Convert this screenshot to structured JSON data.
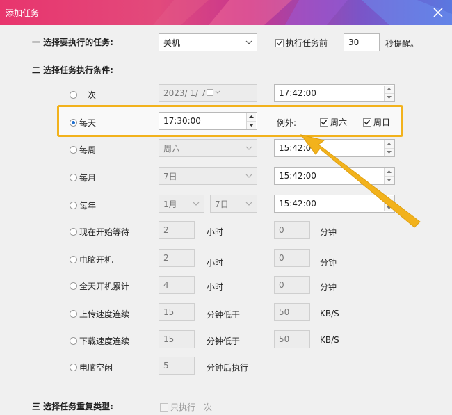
{
  "window": {
    "title": "添加任务"
  },
  "section1": {
    "label": "一 选择要执行的任务:",
    "task_value": "关机",
    "remind_label": "执行任务前",
    "remind_value": "30",
    "remind_suffix": "秒提醒。"
  },
  "section2": {
    "label": "二 选择任务执行条件:",
    "once": {
      "label": "一次",
      "date": "2023/  1/  7",
      "time": "17:42:00"
    },
    "daily": {
      "label": "每天",
      "time": "17:30:00",
      "except_label": "例外:",
      "sat_label": "周六",
      "sun_label": "周日"
    },
    "weekly": {
      "label": "每周",
      "day": "周六",
      "time": "15:42:00"
    },
    "monthly": {
      "label": "每月",
      "day": "7日",
      "time": "15:42:00"
    },
    "yearly": {
      "label": "每年",
      "month": "1月",
      "day": "7日",
      "time": "15:42:00"
    },
    "wait": {
      "label": "现在开始等待",
      "hours": "2",
      "hours_unit": "小时",
      "minutes": "0",
      "minutes_unit": "分钟"
    },
    "boot": {
      "label": "电脑开机",
      "hours": "2",
      "hours_unit": "小时",
      "minutes": "0",
      "minutes_unit": "分钟"
    },
    "cumulative": {
      "label": "全天开机累计",
      "hours": "4",
      "hours_unit": "小时",
      "minutes": "0",
      "minutes_unit": "分钟"
    },
    "upload": {
      "label": "上传速度连续",
      "minutes": "15",
      "minutes_unit": "分钟低于",
      "speed": "50",
      "speed_unit": "KB/S"
    },
    "download": {
      "label": "下载速度连续",
      "minutes": "15",
      "minutes_unit": "分钟低于",
      "speed": "50",
      "speed_unit": "KB/S"
    },
    "idle": {
      "label": "电脑空闲",
      "minutes": "5",
      "minutes_unit": "分钟后执行"
    }
  },
  "section3": {
    "label": "三 选择任务重复类型:",
    "once_only_label": "只执行一次"
  },
  "colors": {
    "highlight": "#f2b21c",
    "accent": "#1f6fd0"
  }
}
